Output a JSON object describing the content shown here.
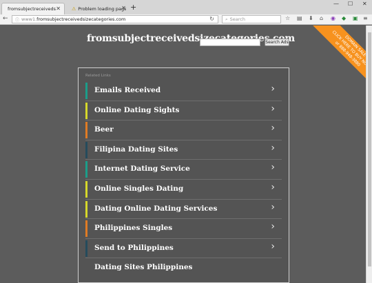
{
  "browser": {
    "tabs": [
      {
        "title": "fromsubjectreceivedsizecategories"
      },
      {
        "title": "Problem loading page"
      }
    ],
    "new_tab": "+",
    "url_prefix": "www1.",
    "url_domain": "fromsubjectreceivedsizecategories.com",
    "search_placeholder": "Search"
  },
  "site": {
    "title": "fromsubjectreceivedsizecategories.com",
    "search_button": "Search Ads",
    "ribbon_lines": [
      "DOMAIN SALE",
      "CLICK HERE TO BUY NOW!",
      "or 888-948-3880"
    ]
  },
  "panel": {
    "header": "Related Links",
    "items": [
      {
        "label": "Emails Received",
        "color": "#1b9e8a",
        "chevron": true
      },
      {
        "label": "Online Dating Sights",
        "color": "#d6d82a",
        "chevron": true
      },
      {
        "label": "Beer",
        "color": "#e07b24",
        "chevron": true
      },
      {
        "label": "Filipina Dating Sites",
        "color": "#254b5c",
        "chevron": true
      },
      {
        "label": "Internet Dating Service",
        "color": "#1b9e8a",
        "chevron": true
      },
      {
        "label": "Online Singles Dating",
        "color": "#d6d82a",
        "chevron": true
      },
      {
        "label": "Dating Online Dating Services",
        "color": "#d6d82a",
        "chevron": true
      },
      {
        "label": "Philippines Singles",
        "color": "#e07b24",
        "chevron": true
      },
      {
        "label": "Send to Philippines",
        "color": "#254b5c",
        "chevron": true
      },
      {
        "label": "Dating Sites Philippines",
        "color": "",
        "chevron": false
      }
    ],
    "chevron_glyph": "›"
  }
}
